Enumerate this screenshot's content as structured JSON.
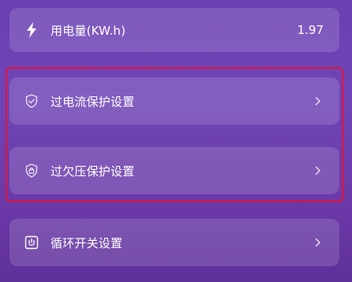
{
  "usage": {
    "label": "用电量(KW.h)",
    "value": "1.97",
    "icon": "lightning-icon"
  },
  "settings": [
    {
      "label": "过电流保护设置",
      "icon": "shield-icon"
    },
    {
      "label": "过欠压保护设置",
      "icon": "lock-shield-icon"
    },
    {
      "label": "循环开关设置",
      "icon": "cycle-switch-icon"
    }
  ],
  "colors": {
    "background_top": "#6a3fb2",
    "background_bottom": "#5f2f9b",
    "highlight": "#e3123a",
    "text": "#ffffff"
  }
}
